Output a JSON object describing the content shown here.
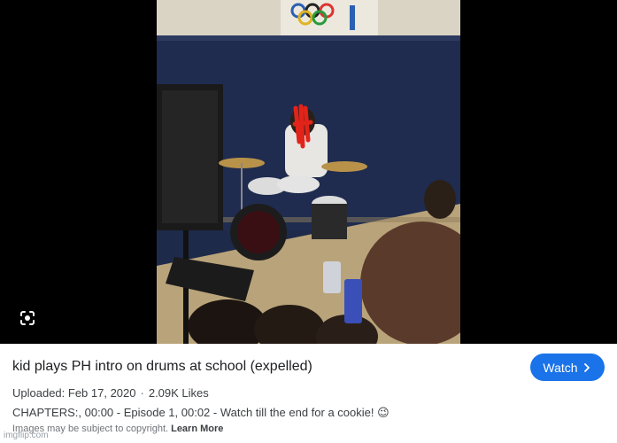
{
  "result": {
    "title": "kid plays PH intro on drums at school (expelled)",
    "watch_button": {
      "label": "Watch",
      "icon": "chevron-right-icon"
    },
    "uploaded": "Uploaded: Feb 17, 2020",
    "separator": "·",
    "likes": "2.09K Likes",
    "chapters": "CHAPTERS:, 00:00 - Episode 1, 00:02 - Watch till the end for a cookie! 😉",
    "copyright_notice": "Images may be subject to copyright.",
    "learn_more": "Learn More"
  },
  "media": {
    "lens_icon": "google-lens-icon"
  },
  "watermark": "imgflip.com",
  "colors": {
    "accent": "#1a73e8",
    "media_background": "#000000",
    "gym_wall": "#1e2a4a",
    "gym_floor": "#b9a37a",
    "scribble": "#e2231a"
  }
}
